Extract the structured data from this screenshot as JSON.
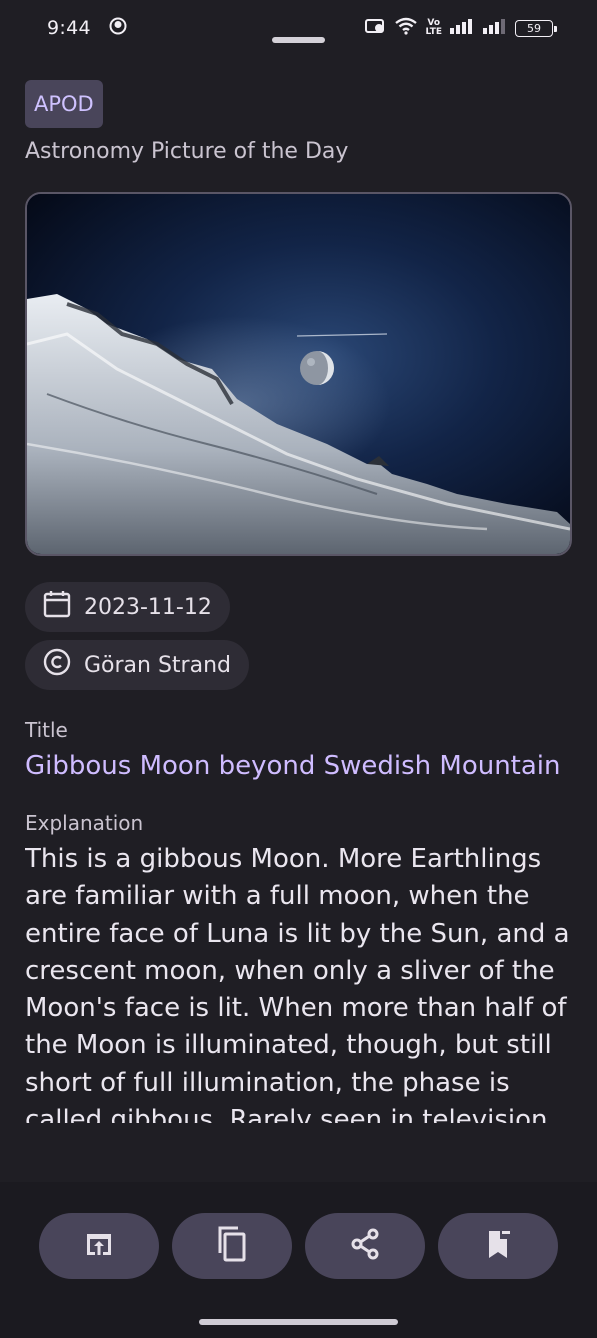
{
  "status": {
    "time": "9:44",
    "lte_top": "Vo",
    "lte_bottom": "LTE",
    "battery": "59"
  },
  "header": {
    "badge": "APOD",
    "subtitle": "Astronomy Picture of the Day"
  },
  "meta": {
    "date": "2023-11-12",
    "copyright": "Göran Strand"
  },
  "title_section": {
    "label": "Title",
    "value": "Gibbous Moon beyond Swedish Mountain"
  },
  "explanation_section": {
    "label": "Explanation",
    "value": "This is a gibbous Moon. More Earthlings are familiar with a full moon, when the entire face of Luna is lit by the Sun, and a crescent moon, when only a sliver of the Moon's face is lit.  When more than half of the Moon is illuminated, though, but still short of full illumination, the phase is called gibbous.  Rarely seen in television"
  },
  "actions": [
    {
      "icon": "open-in-browser-icon"
    },
    {
      "icon": "copy-icon"
    },
    {
      "icon": "share-icon"
    },
    {
      "icon": "bookmark-add-icon"
    }
  ],
  "colors": {
    "background": "#1f1e24",
    "accent": "#cfbcff",
    "chip": "#49455a"
  }
}
